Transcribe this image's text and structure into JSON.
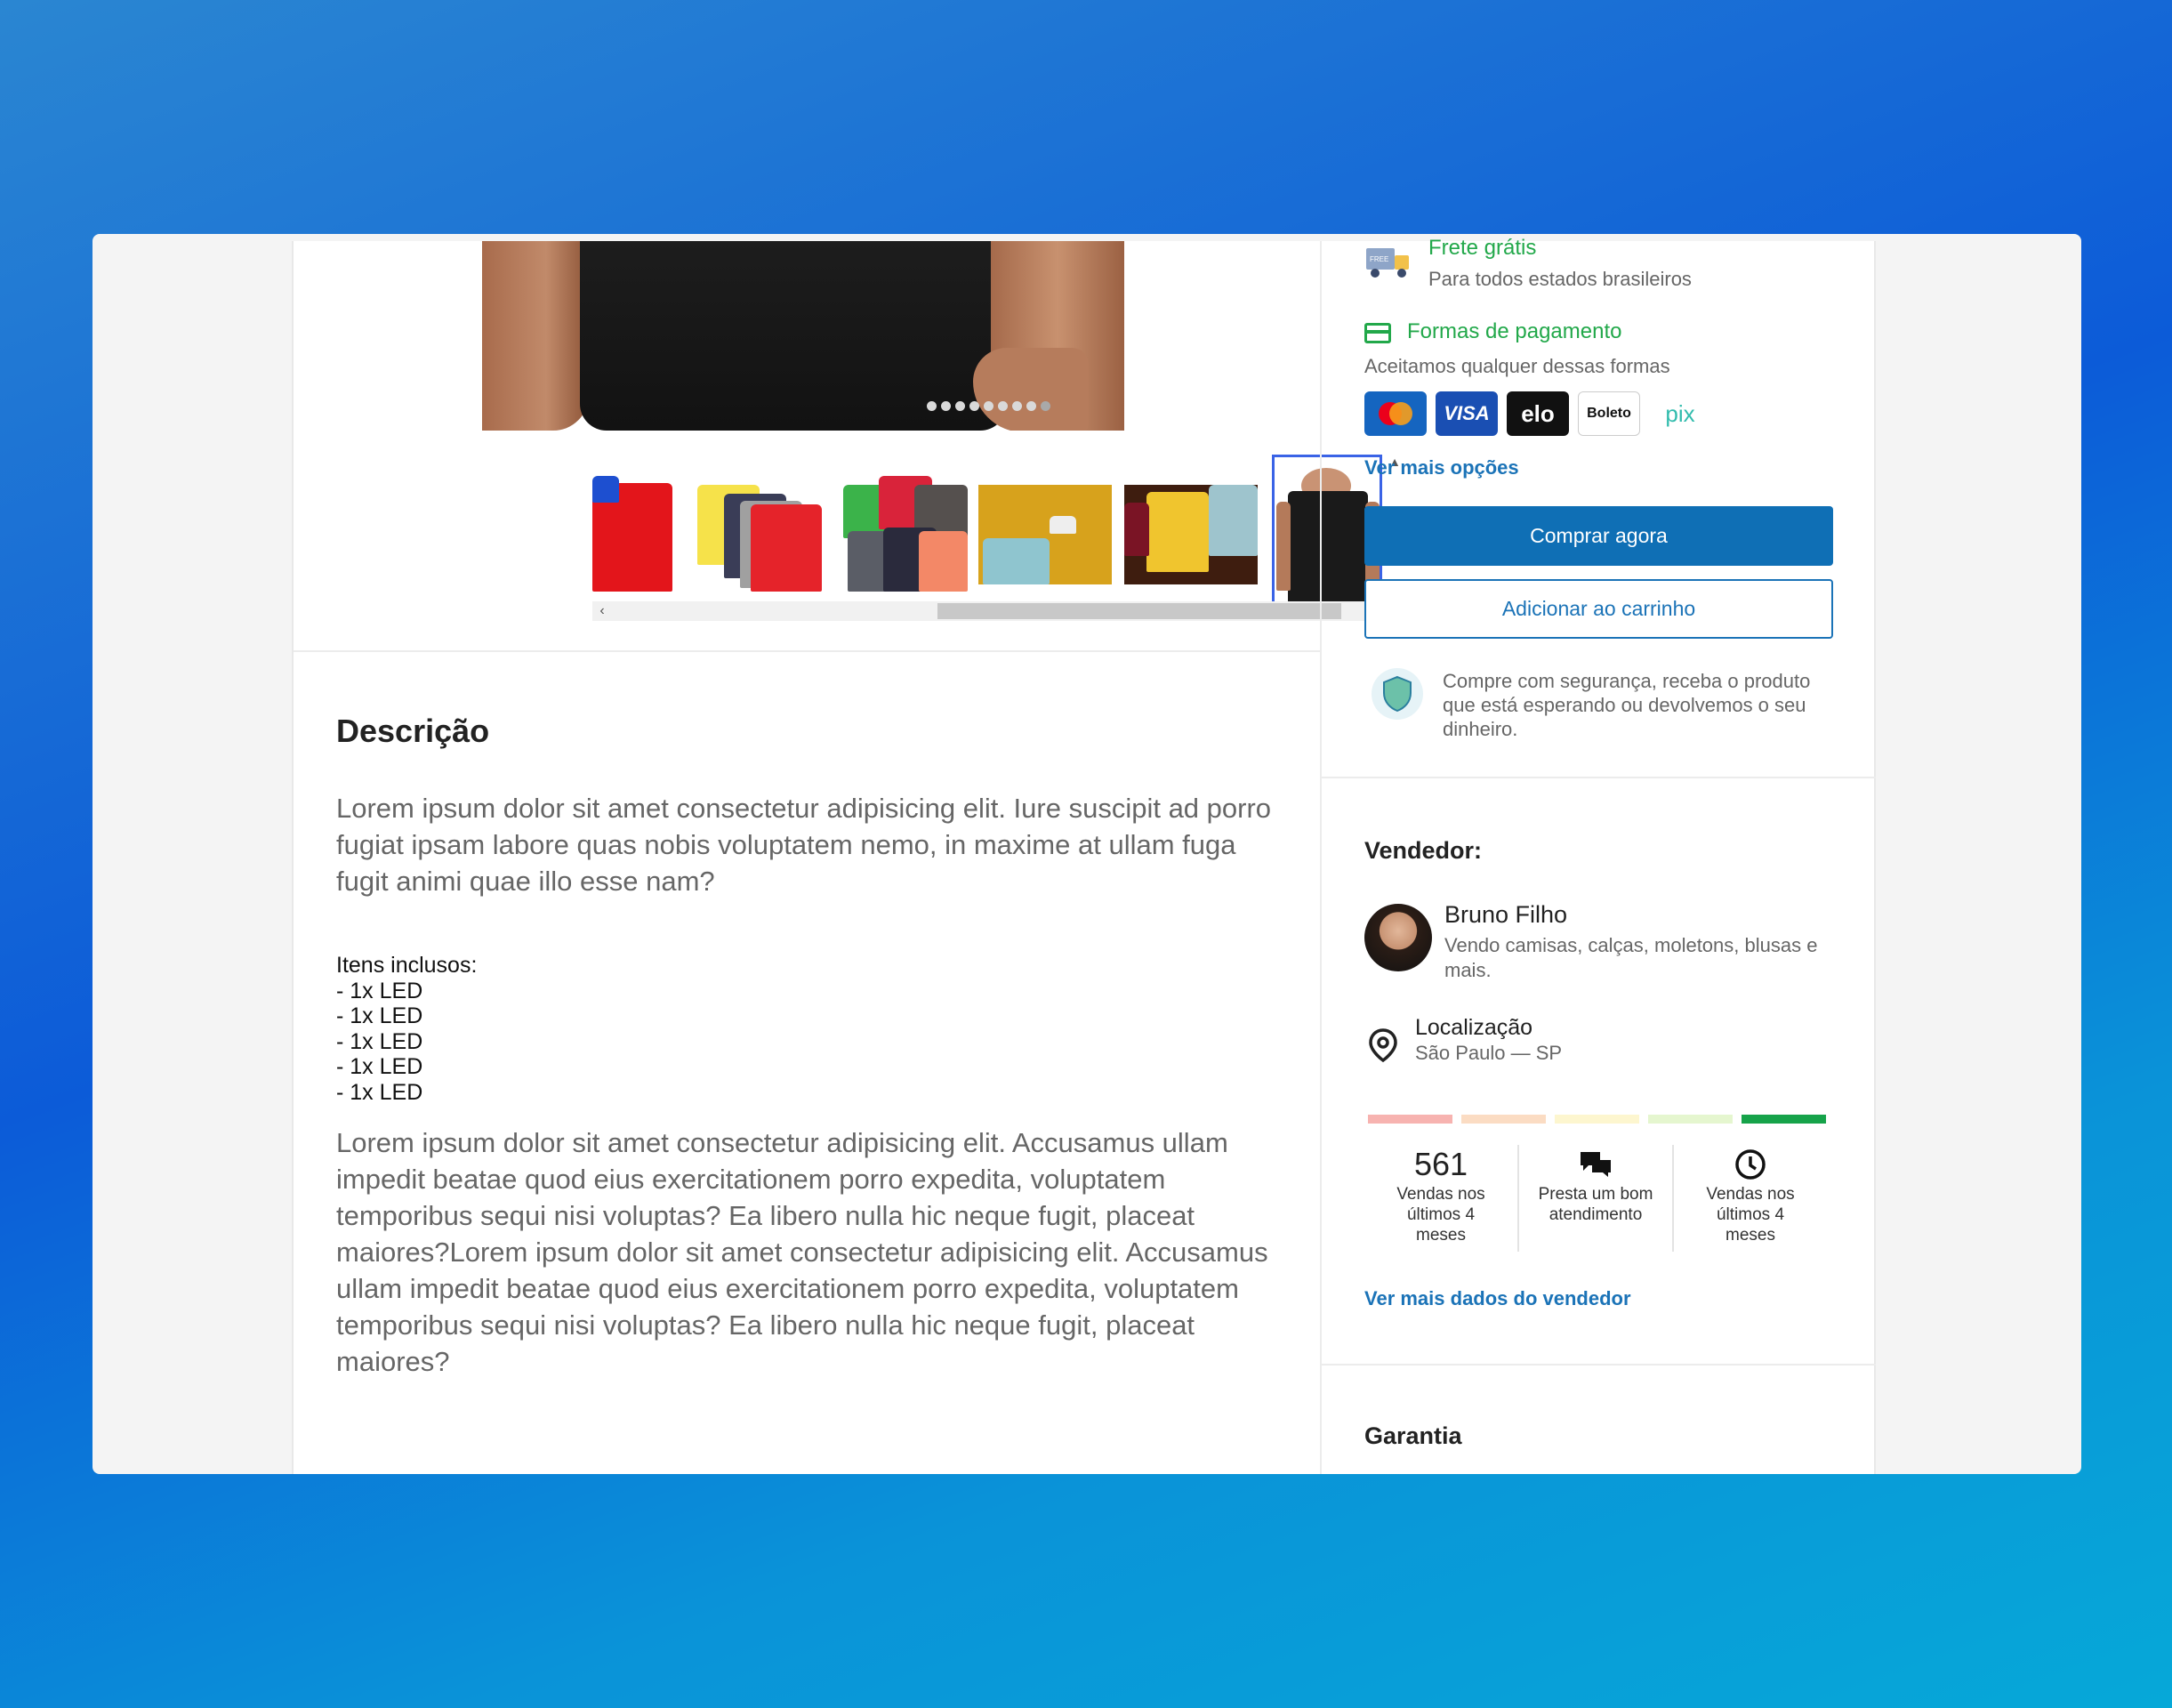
{
  "description": {
    "title": "Descrição",
    "paragraph_1": "Lorem ipsum dolor sit amet consectetur adipisicing elit. Iure suscipit ad porro fugiat ipsam labore quas nobis voluptatem nemo, in maxime at ullam fuga fugit animi quae illo esse nam?",
    "items_label": "Itens inclusos:",
    "items": [
      "- 1x LED",
      "- 1x LED",
      "- 1x LED",
      "- 1x LED",
      "- 1x LED"
    ],
    "paragraph_2": "Lorem ipsum dolor sit amet consectetur adipisicing elit. Accusamus ullam impedit beatae quod eius exercitationem porro expedita, voluptatem temporibus sequi nisi voluptas? Ea libero nulla hic neque fugit, placeat maiores?Lorem ipsum dolor sit amet consectetur adipisicing elit. Accusamus ullam impedit beatae quod eius exercitationem porro expedita, voluptatem temporibus sequi nisi voluptas? Ea libero nulla hic neque fugit, placeat maiores?"
  },
  "gallery": {
    "dot_count": 9,
    "active_dot": 8,
    "selected_thumb": 5
  },
  "shipping": {
    "title": "Frete grátis",
    "subtitle": "Para todos estados brasileiros",
    "truck_badge": "FREE"
  },
  "payment": {
    "title": "Formas de pagamento",
    "subtitle": "Aceitamos qualquer dessas formas",
    "methods": [
      "VISA",
      "elo",
      "Boleto",
      "pix"
    ],
    "more_link": "Ver mais opções"
  },
  "actions": {
    "buy_now": "Comprar agora",
    "add_to_cart": "Adicionar ao carrinho"
  },
  "security": {
    "text": "Compre com segurança, receba o produto que está esperando ou devolvemos o seu dinheiro."
  },
  "seller": {
    "heading": "Vendedor:",
    "name": "Bruno Filho",
    "bio": "Vendo camisas, calças, moletons, blusas e mais.",
    "location_label": "Localização",
    "location_value": "São Paulo — SP",
    "reputation_colors": [
      "#f7b3b0",
      "#fbdcc3",
      "#fdf6cf",
      "#e5f6cf",
      "#16a34a"
    ],
    "stats": [
      {
        "value": "561",
        "label": "Vendas nos últimos 4 meses"
      },
      {
        "label": "Presta um bom atendimento"
      },
      {
        "label": "Vendas nos últimos 4 meses"
      }
    ],
    "more_link": "Ver mais dados do vendedor"
  },
  "warranty": {
    "heading": "Garantia"
  },
  "colors": {
    "primary": "#0f6fb5",
    "green": "#22a84a",
    "link": "#1b73b7"
  }
}
